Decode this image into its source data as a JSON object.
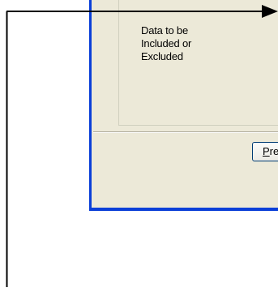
{
  "groupbox": {
    "lines": [
      "Data to be",
      "Included or",
      "Excluded"
    ]
  },
  "button": {
    "mnemonic": "P",
    "rest": "re"
  },
  "colors": {
    "titlebar_border": "#0a3fd8",
    "dialog_face": "#ece9d8",
    "connector": "#000000"
  },
  "icons": {
    "arrow": "arrow-right-icon"
  }
}
